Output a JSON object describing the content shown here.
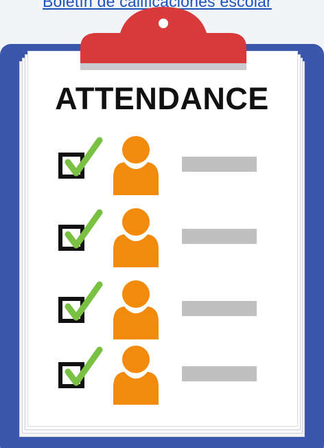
{
  "header": {
    "link_text": "Boletín de calificaciones escolar"
  },
  "clipboard": {
    "title": "ATTENDANCE",
    "board_color": "#3a56ad",
    "clip_color": "#d8393b",
    "rows": [
      {
        "checked": true,
        "icon": "person-icon"
      },
      {
        "checked": true,
        "icon": "person-icon"
      },
      {
        "checked": true,
        "icon": "person-icon"
      },
      {
        "checked": true,
        "icon": "person-icon"
      }
    ]
  },
  "colors": {
    "check": "#7ac043",
    "person": "#f28a0c",
    "placeholder_line": "#c0c0c0",
    "link": "#1d53b8"
  }
}
